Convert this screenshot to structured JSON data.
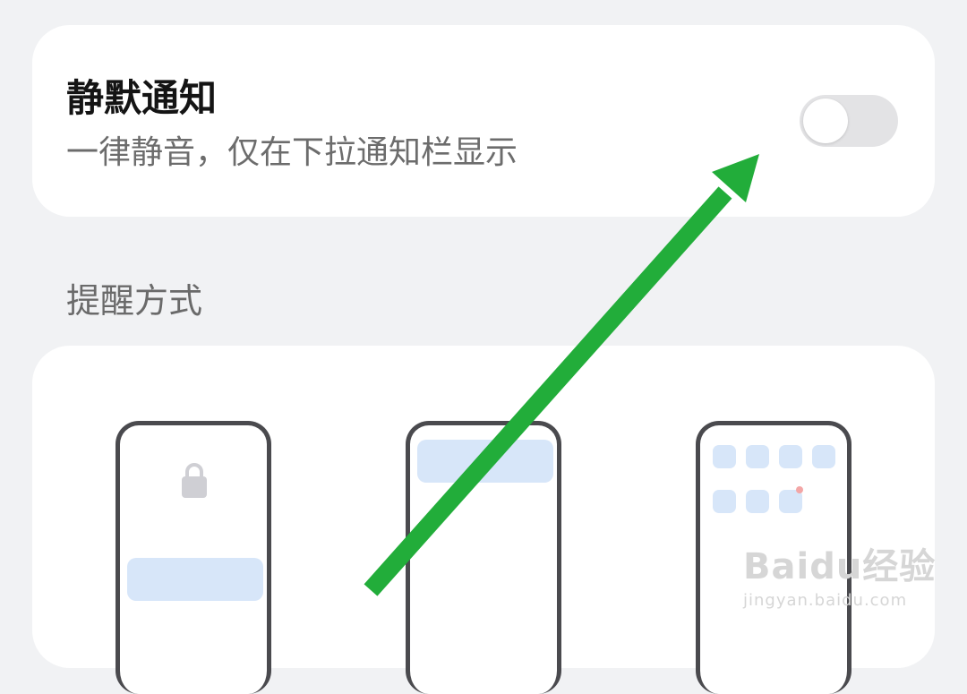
{
  "silent_notification": {
    "title": "静默通知",
    "subtitle": "一律静音，仅在下拉通知栏显示",
    "toggle_on": false
  },
  "reminder_section": {
    "label": "提醒方式",
    "options": [
      {
        "icon": "lock-screen-preview-icon"
      },
      {
        "icon": "banner-preview-icon"
      },
      {
        "icon": "home-screen-badge-preview-icon"
      }
    ]
  },
  "watermark": {
    "brand": "Baidu经验",
    "url": "jingyan.baidu.com"
  },
  "colors": {
    "background": "#f1f2f4",
    "card": "#ffffff",
    "toggle_off": "#e3e3e5",
    "preview_accent": "#d7e6f9",
    "badge_dot": "#f3a6a6",
    "annotation_arrow": "#22ad3a"
  }
}
